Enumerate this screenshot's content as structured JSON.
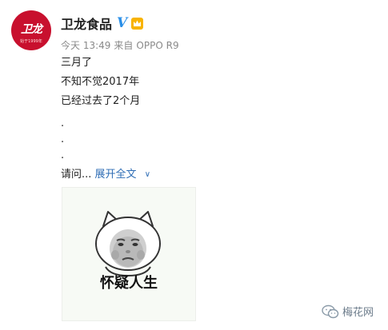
{
  "post": {
    "username": "卫龙食品",
    "avatar_text": "卫龙",
    "avatar_tag": "始于1999年",
    "verified_badge": "V",
    "time": "今天 13:49",
    "source_prefix": "来自",
    "source_device": "OPPO R9",
    "lines": [
      "三月了",
      "不知不觉2017年",
      "已经过去了2个月"
    ],
    "dots": [
      ".",
      ".",
      "."
    ],
    "truncated_text": "请问...",
    "expand_label": "展开全文",
    "image_caption": "怀疑人生"
  },
  "watermark": {
    "text": "梅花网"
  },
  "colors": {
    "brand_red": "#c8102e",
    "link_blue": "#2e6db5",
    "verify_blue": "#2a8fe8",
    "meta_gray": "#8a8a8a"
  },
  "icons": [
    "verified-v-icon",
    "member-crown-icon",
    "chevron-down-icon",
    "wechat-icon"
  ]
}
